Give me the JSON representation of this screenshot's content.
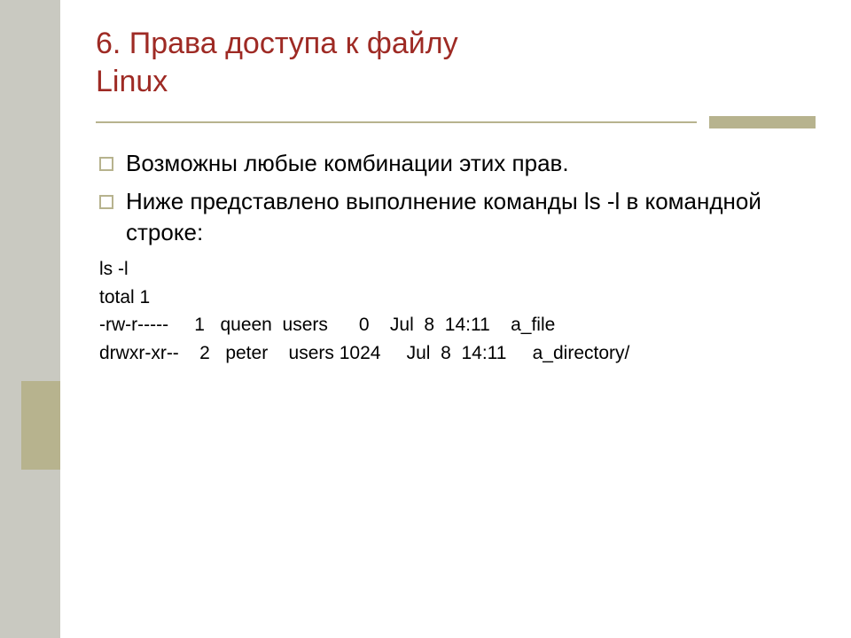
{
  "title_line1": "6. Права доступа к файлу",
  "title_line2": "Linux",
  "bullets": [
    "Возможны любые комбинации этих прав.",
    "Ниже представлено выполнение команды ls -l в командной строке:"
  ],
  "code_lines": [
    "ls -l",
    "total 1",
    "-rw-r-----     1   queen  users      0    Jul  8  14:11    a_file",
    "drwxr-xr--    2   peter    users 1024     Jul  8  14:11     a_directory/"
  ]
}
